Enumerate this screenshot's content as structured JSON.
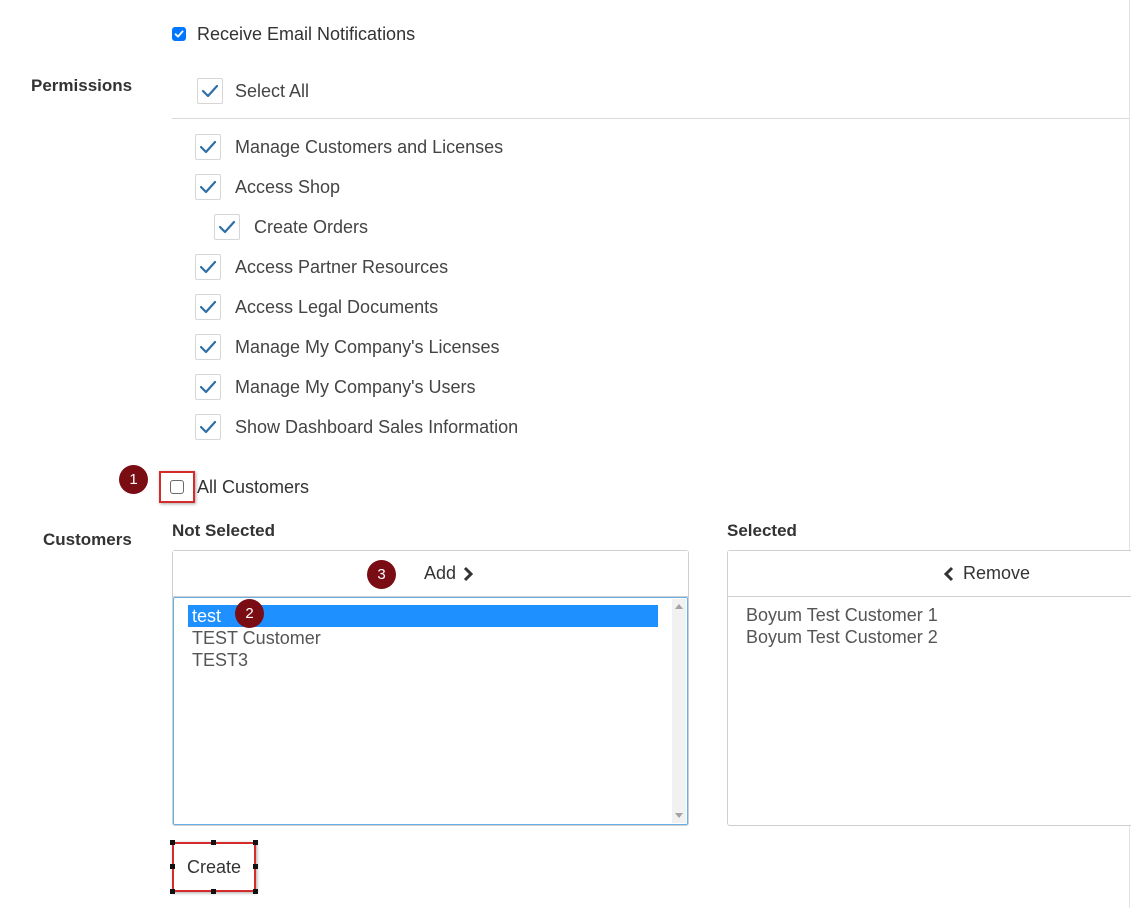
{
  "notifications": {
    "receive_email_label": "Receive Email Notifications",
    "receive_email_checked": true
  },
  "permissions": {
    "label": "Permissions",
    "select_all_label": "Select All",
    "items": [
      {
        "label": "Manage Customers and Licenses",
        "checked": true,
        "indent": 0
      },
      {
        "label": "Access Shop",
        "checked": true,
        "indent": 0
      },
      {
        "label": "Create Orders",
        "checked": true,
        "indent": 1
      },
      {
        "label": "Access Partner Resources",
        "checked": true,
        "indent": 0
      },
      {
        "label": "Access Legal Documents",
        "checked": true,
        "indent": 0
      },
      {
        "label": "Manage My Company's Licenses",
        "checked": true,
        "indent": 0
      },
      {
        "label": "Manage My Company's Users",
        "checked": true,
        "indent": 0
      },
      {
        "label": "Show Dashboard Sales Information",
        "checked": true,
        "indent": 0
      }
    ]
  },
  "customers": {
    "label": "Customers",
    "all_customers_label": "All Customers",
    "all_customers_checked": false,
    "not_selected": {
      "header": "Not Selected",
      "add_label": "Add",
      "items": [
        "test",
        "TEST Customer",
        "TEST3"
      ],
      "selected_item": "test"
    },
    "selected": {
      "header": "Selected",
      "remove_label": "Remove",
      "items": [
        "Boyum Test Customer 1",
        "Boyum Test Customer 2"
      ]
    }
  },
  "annotations": {
    "step1": "1",
    "step2": "2",
    "step3": "3"
  },
  "create_label": "Create",
  "colors": {
    "check_blue": "#2f6fa7",
    "native_check": "#0075ff",
    "selection": "#1e90ff",
    "highlight_red": "#d62b2b",
    "badge": "#7a0c14"
  }
}
